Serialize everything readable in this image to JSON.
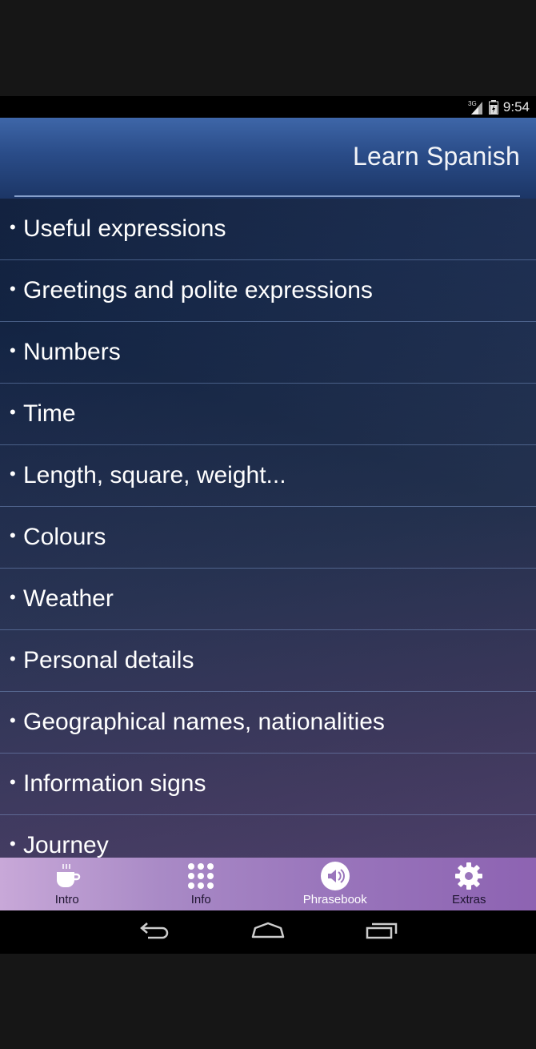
{
  "status_bar": {
    "network": "3G",
    "time": "9:54",
    "icons": [
      "signal-icon",
      "battery-icon"
    ]
  },
  "header": {
    "title": "Learn Spanish"
  },
  "menu": {
    "bullet": "•",
    "items": [
      {
        "label": "Useful expressions"
      },
      {
        "label": "Greetings and polite expressions"
      },
      {
        "label": "Numbers"
      },
      {
        "label": "Time"
      },
      {
        "label": "Length, square, weight..."
      },
      {
        "label": "Colours"
      },
      {
        "label": "Weather"
      },
      {
        "label": "Personal details"
      },
      {
        "label": "Geographical names, nationalities"
      },
      {
        "label": "Information signs"
      },
      {
        "label": "Journey"
      }
    ]
  },
  "tabs": [
    {
      "label": "Intro",
      "icon": "coffee-cup-icon"
    },
    {
      "label": "Info",
      "icon": "grid-dots-icon"
    },
    {
      "label": "Phrasebook",
      "icon": "speaker-icon",
      "active": true
    },
    {
      "label": "Extras",
      "icon": "gear-icon"
    }
  ],
  "navigation": {
    "buttons": [
      "back-icon",
      "home-icon",
      "recents-icon"
    ]
  },
  "colors": {
    "header_blue": "#2a4c88",
    "tab_bar_purple": "#9a76bc",
    "divider": "#82a0d2"
  }
}
